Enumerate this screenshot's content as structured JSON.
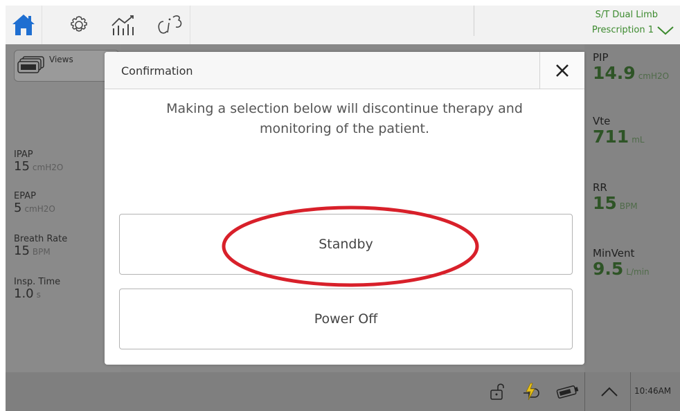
{
  "topbar": {
    "mode": "S/T  Dual Limb",
    "prescription": "Prescription 1"
  },
  "left_panel": {
    "views_label": "Views",
    "params": [
      {
        "label": "IPAP",
        "value": "15",
        "unit": "cmH2O"
      },
      {
        "label": "EPAP",
        "value": "5",
        "unit": "cmH2O"
      },
      {
        "label": "Breath Rate",
        "value": "15",
        "unit": "BPM"
      },
      {
        "label": "Insp. Time",
        "value": "1.0",
        "unit": "s"
      }
    ]
  },
  "right_panel": {
    "params": [
      {
        "label": "PIP",
        "value": "14.9",
        "unit": "cmH2O"
      },
      {
        "label": "Vte",
        "value": "711",
        "unit": "mL"
      },
      {
        "label": "RR",
        "value": "15",
        "unit": "BPM"
      },
      {
        "label": "MinVent",
        "value": "9.5",
        "unit": "L/min"
      }
    ]
  },
  "dialog": {
    "title": "Confirmation",
    "message": "Making a selection below will discontinue therapy and monitoring of the patient.",
    "standby_label": "Standby",
    "poweroff_label": "Power Off"
  },
  "statusbar": {
    "time": "10:46AM"
  },
  "colors": {
    "home_icon": "#1f6fd1",
    "mode_text": "#3c8a2e",
    "measured_value": "#2e5426",
    "highlight_ring": "#d8202a",
    "power_icon": "#e8c21a"
  },
  "icons": [
    "home-icon",
    "settings-icon",
    "trends-icon",
    "ci-icon",
    "views-icon",
    "chevron-down-icon",
    "close-icon",
    "lock-icon",
    "power-plug-icon",
    "battery-icon",
    "chevron-up-icon"
  ]
}
